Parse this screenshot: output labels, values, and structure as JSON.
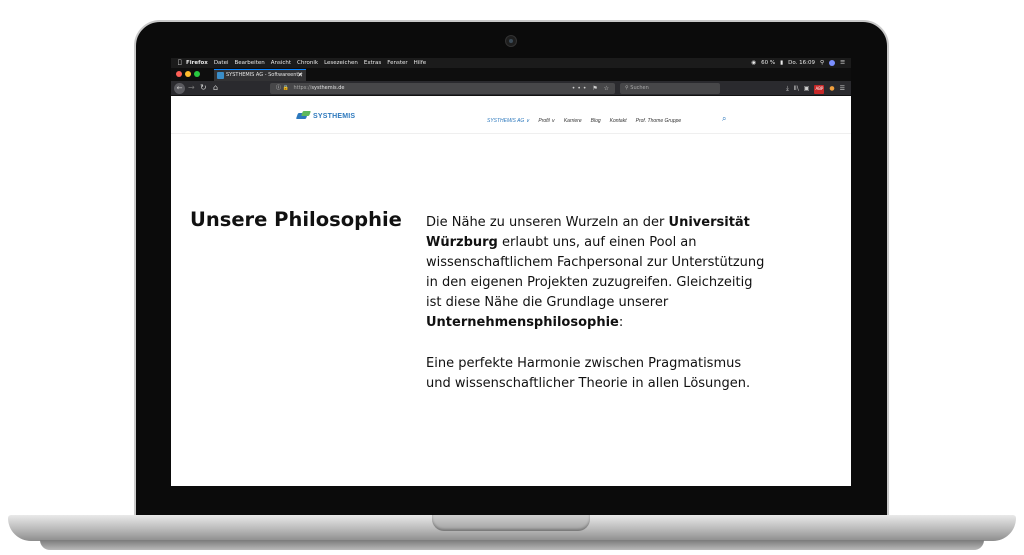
{
  "mac_menubar": {
    "apple": "",
    "items": [
      "Firefox",
      "Datei",
      "Bearbeiten",
      "Ansicht",
      "Chronik",
      "Lesezeichen",
      "Extras",
      "Fenster",
      "Hilfe"
    ],
    "battery": "60 %",
    "datetime": "Do. 16:09"
  },
  "browser": {
    "tab_title": "SYSTHEMIS AG - Softwareentw",
    "tab_close": "✕",
    "url_scheme": "https://",
    "url_host": "systhemis.de",
    "url_actions": "••• ⚑ ☆",
    "search_placeholder": "Suchen",
    "toolbar_icons": [
      "⤓",
      "Ⅱ\\",
      "▣",
      "☰"
    ],
    "abp_label": "ABP"
  },
  "site": {
    "logo_text": "SYSTHEMIS",
    "nav": [
      {
        "label": "SYSTHEMIS AG ∨",
        "active": true
      },
      {
        "label": "Profil ∨"
      },
      {
        "label": "Karriere"
      },
      {
        "label": "Blog"
      },
      {
        "label": "Kontakt"
      },
      {
        "label": "Prof. Thome Gruppe"
      }
    ],
    "search_icon": "⌕"
  },
  "content": {
    "title": "Unsere Philosophie",
    "p1_a": "Die Nähe zu unseren Wurzeln an der ",
    "p1_b": "Universität Würzburg",
    "p1_c": " erlaubt uns, auf einen Pool an wissenschaftlichem Fachpersonal zur Unterstützung in den eigenen Projekten zuzugreifen. Gleichzeitig ist diese Nähe die Grundlage unserer ",
    "p1_d": "Unternehmensphilosophie",
    "p1_e": ":",
    "p2": "Eine perfekte Harmonie zwischen Pragmatismus und wissenschaftlicher Theorie in allen Lösungen."
  },
  "colors": {
    "brand_blue": "#2c78bd",
    "brand_green": "#5cb85c"
  }
}
